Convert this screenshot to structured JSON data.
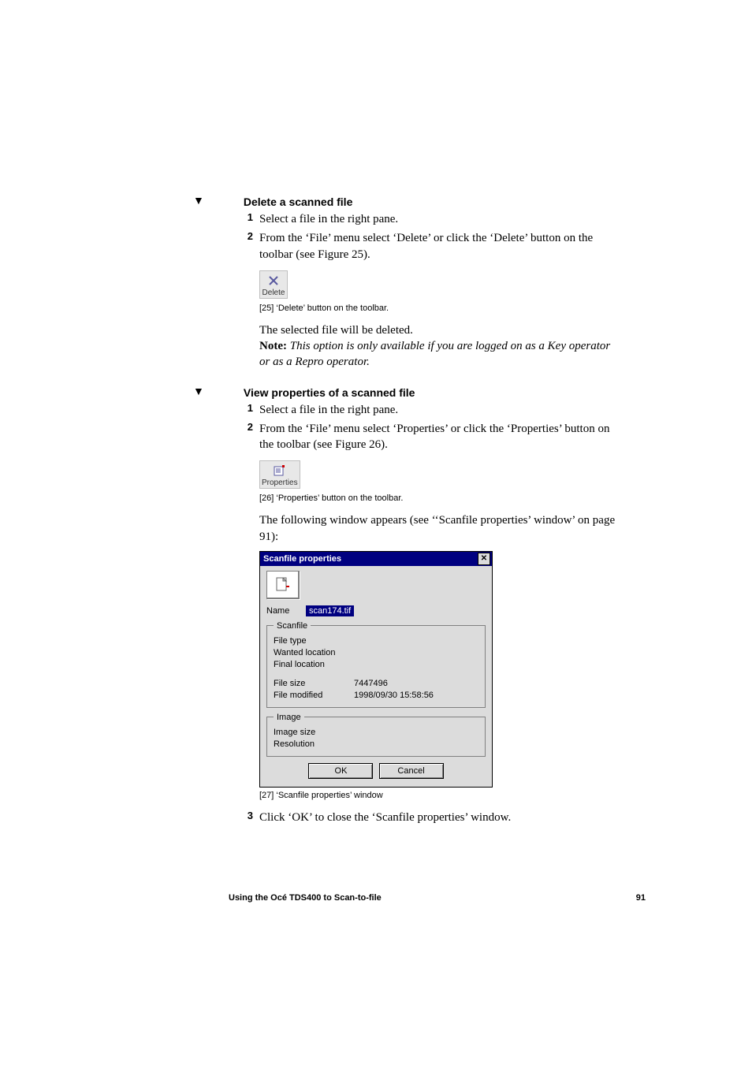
{
  "section1": {
    "heading": "Delete a scanned file",
    "step1_num": "1",
    "step1_text": "Select a file in the right pane.",
    "step2_num": "2",
    "step2_text": "From the ‘File’ menu select ‘Delete’ or click the ‘Delete’ button on the toolbar (see Figure 25).",
    "btn_label": "Delete",
    "caption": "[25] ‘Delete’ button on the toolbar.",
    "result_line": "The selected file will be deleted.",
    "note_label": "Note:",
    "note_text": " This option is only available if you are logged on as a Key operator or as a Repro operator."
  },
  "section2": {
    "heading": "View properties of a scanned file",
    "step1_num": "1",
    "step1_text": "Select a file in the right pane.",
    "step2_num": "2",
    "step2_text": "From the ‘File’ menu select ‘Properties’ or click the ‘Properties’ button on the toolbar (see Figure 26).",
    "btn_label": "Properties",
    "caption": "[26] ‘Properties’ button on the toolbar.",
    "following_text": "The following window appears (see ‘‘Scanfile properties’ window’ on page 91):",
    "dialog": {
      "title": "Scanfile properties",
      "name_label": "Name",
      "name_value": "scan174.tif",
      "group_scanfile": "Scanfile",
      "file_type_label": "File type",
      "wanted_location_label": "Wanted location",
      "final_location_label": "Final location",
      "file_size_label": "File size",
      "file_size_value": "7447496",
      "file_modified_label": "File modified",
      "file_modified_value": "1998/09/30 15:58:56",
      "group_image": "Image",
      "image_size_label": "Image size",
      "resolution_label": "Resolution",
      "ok_label": "OK",
      "cancel_label": "Cancel"
    },
    "dialog_caption": "[27] ‘Scanfile properties’ window",
    "step3_num": "3",
    "step3_text": "Click ‘OK’ to close the ‘Scanfile properties’ window."
  },
  "footer": {
    "left": "Using the Océ TDS400 to Scan-to-file",
    "right": "91"
  }
}
